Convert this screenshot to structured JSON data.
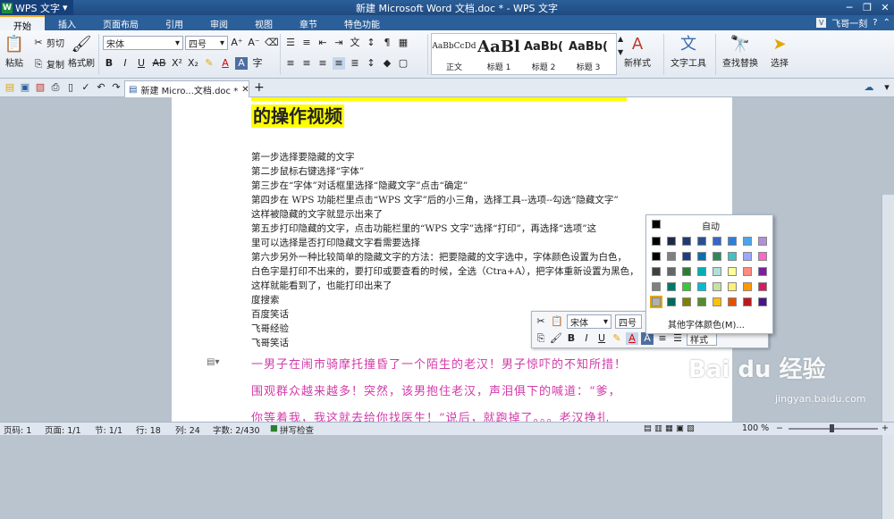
{
  "app": {
    "wps_label": "WPS 文字",
    "title": "新建 Microsoft Word 文档.doc * - WPS 文字",
    "user": "飞哥一刻"
  },
  "menu_tabs": [
    "开始",
    "插入",
    "页面布局",
    "引用",
    "审阅",
    "视图",
    "章节",
    "特色功能"
  ],
  "ribbon": {
    "paste": "粘贴",
    "cut": "剪切",
    "copy": "复制",
    "format_painter": "格式刷",
    "font": "宋体",
    "font_size": "四号",
    "styles": [
      {
        "preview": "AaBbCcDd",
        "label": "正文"
      },
      {
        "preview": "AaBl",
        "label": "标题 1"
      },
      {
        "preview": "AaBb(",
        "label": "标题 2"
      },
      {
        "preview": "AaBb(",
        "label": "标题 3"
      }
    ],
    "new_style": "新样式",
    "text_tools": "文字工具",
    "find_replace": "查找替换",
    "select": "选择"
  },
  "doc_tab": "新建 Micro...文档.doc *",
  "document": {
    "heading": "的操作视频",
    "lines": [
      "第一步选择要隐藏的文字",
      "第二步鼠标右键选择“字体”",
      "第三步在“字体”对话框里选择“隐藏文字”点击“确定”",
      "第四步在 WPS 功能栏里点击“WPS 文字”后的小三角，选择工具--选项--勾选“隐藏文字”",
      "这样被隐藏的文字就显示出来了",
      "第五步打印隐藏的文字，点击功能栏里的“WPS 文字”选择“打印”，再选择“选项”这",
      "里可以选择是否打印隐藏文字看需要选择",
      "第六步另外一种比较简单的隐藏文字的方法：把要隐藏的文字选中，字体颜色设置为白色，",
      "白色字是打印不出来的，要打印或要查看的时候，全选（Ctra+A），把字体重新设置为黑色，",
      "这样就能看到了，也能打印出来了",
      "度搜索",
      "百度笑话",
      "飞哥经验",
      "飞哥笑话"
    ],
    "pink_lines": [
      "一男子在闹市骑摩托撞昏了一个陌生的老汉！男子惊吓的不知所措！",
      "围观群众越来越多！突然，该男抱住老汉，声泪俱下的喊道：“爹，",
      "你等着我，我这就去给你找医生！”说后，就跑掉了。。。老汉挣扎"
    ]
  },
  "mini_toolbar": {
    "font": "宋体",
    "size": "四号",
    "styles": "样式"
  },
  "color_palette": {
    "auto": "自动",
    "more": "其他字体颜色(M)...",
    "auto_color": "#000000",
    "rows": [
      [
        "#000000",
        "#1f2a44",
        "#1f3b73",
        "#2a4f8f",
        "#3566c8",
        "#2f7fd9",
        "#4aa6e6",
        "#b090d8"
      ],
      [
        "#000000",
        "#808080",
        "#1e3a8a",
        "#0b6fae",
        "#2e8b57",
        "#44c1c1",
        "#9aa8ff",
        "#ff66cc"
      ],
      [
        "#404040",
        "#666666",
        "#2e7d32",
        "#00b0b0",
        "#b2dfdb",
        "#ffff99",
        "#ff8a80",
        "#7b1fa2"
      ],
      [
        "#808080",
        "#00796b",
        "#33cc33",
        "#00bcd4",
        "#c5e1a5",
        "#fff176",
        "#ff9800",
        "#d81b60"
      ],
      [
        "#b0b0b0",
        "#00695c",
        "#808000",
        "#558b2f",
        "#ffc107",
        "#e65100",
        "#b71c1c",
        "#4a148c"
      ]
    ]
  },
  "status": {
    "page": "页码: 1",
    "pages": "页面: 1/1",
    "section": "节: 1/1",
    "row": "行: 18",
    "col": "列: 24",
    "words": "字数: 2/430",
    "spell": "拼写检查",
    "zoom": "100 %"
  },
  "watermark": {
    "brand": "Bai du 经验",
    "url": "jingyan.baidu.com"
  }
}
